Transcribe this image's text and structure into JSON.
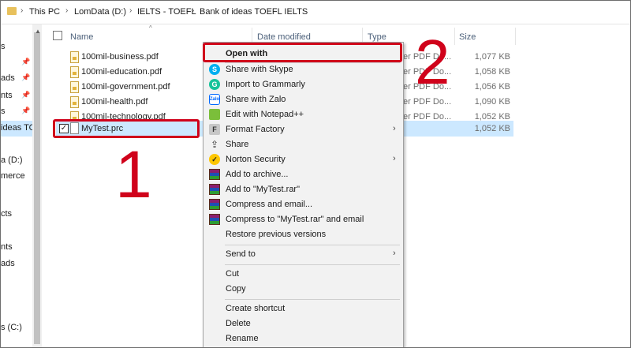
{
  "breadcrumb": {
    "items": [
      "This PC",
      "LomData (D:)",
      "IELTS - TOEFL",
      "Bank of ideas TOEFL IELTS"
    ],
    "separator": "›"
  },
  "nav": {
    "items": [
      "s",
      "ads",
      "nts",
      "s",
      "ideas TO",
      "a (D:)",
      "merce",
      "cts",
      "nts",
      "ads",
      "s (C:)"
    ]
  },
  "columns": {
    "name": "Name",
    "date_modified": "Date modified",
    "type": "Type",
    "size": "Size"
  },
  "files": [
    {
      "name": "100mil-business.pdf",
      "type": "er PDF Do...",
      "size": "1,077 KB"
    },
    {
      "name": "100mil-education.pdf",
      "type": "er PDF Do...",
      "size": "1,058 KB"
    },
    {
      "name": "100mil-government.pdf",
      "type": "er PDF Do...",
      "size": "1,056 KB"
    },
    {
      "name": "100mil-health.pdf",
      "type": "er PDF Do...",
      "size": "1,090 KB"
    },
    {
      "name": "100mil-technology.pdf",
      "type": "er PDF Do...",
      "size": "1,052 KB"
    },
    {
      "name": "MyTest.prc",
      "type": "",
      "size": "1,052 KB",
      "selected": true,
      "checked": "✓"
    }
  ],
  "context_menu": {
    "items": [
      {
        "label": "Open with",
        "icon": "none",
        "bold": true
      },
      {
        "label": "Share with Skype",
        "icon": "skype-icon",
        "glyph": "S"
      },
      {
        "label": "Import to Grammarly",
        "icon": "grammarly-icon",
        "glyph": "G"
      },
      {
        "label": "Share with Zalo",
        "icon": "zalo-icon",
        "glyph": "Zalo"
      },
      {
        "label": "Edit with Notepad++",
        "icon": "notepad-plus-plus-icon",
        "glyph": ""
      },
      {
        "label": "Format Factory",
        "icon": "format-factory-icon",
        "glyph": "F",
        "submenu": true
      },
      {
        "label": "Share",
        "icon": "share-icon",
        "glyph": "⇪"
      },
      {
        "label": "Norton Security",
        "icon": "norton-icon",
        "glyph": "✓",
        "submenu": true
      },
      {
        "label": "Add to archive...",
        "icon": "winrar-icon",
        "glyph": ""
      },
      {
        "label": "Add to \"MyTest.rar\"",
        "icon": "winrar-icon",
        "glyph": ""
      },
      {
        "label": "Compress and email...",
        "icon": "winrar-icon",
        "glyph": ""
      },
      {
        "label": "Compress to \"MyTest.rar\" and email",
        "icon": "winrar-icon",
        "glyph": ""
      },
      {
        "label": "Restore previous versions",
        "icon": "none",
        "glyph": ""
      },
      {
        "label": "Send to",
        "icon": "none",
        "glyph": "",
        "submenu": true
      },
      {
        "label": "Cut",
        "icon": "none",
        "glyph": ""
      },
      {
        "label": "Copy",
        "icon": "none",
        "glyph": ""
      },
      {
        "label": "Create shortcut",
        "icon": "none",
        "glyph": ""
      },
      {
        "label": "Delete",
        "icon": "none",
        "glyph": ""
      },
      {
        "label": "Rename",
        "icon": "none",
        "glyph": ""
      }
    ],
    "submenu_arrow": "›"
  },
  "annotations": {
    "step1": "1",
    "step2": "2",
    "color": "#d0021b"
  },
  "colors": {
    "selection": "#cce8ff",
    "menu_bg": "#f2f2f2",
    "header_text": "#4c607a"
  }
}
